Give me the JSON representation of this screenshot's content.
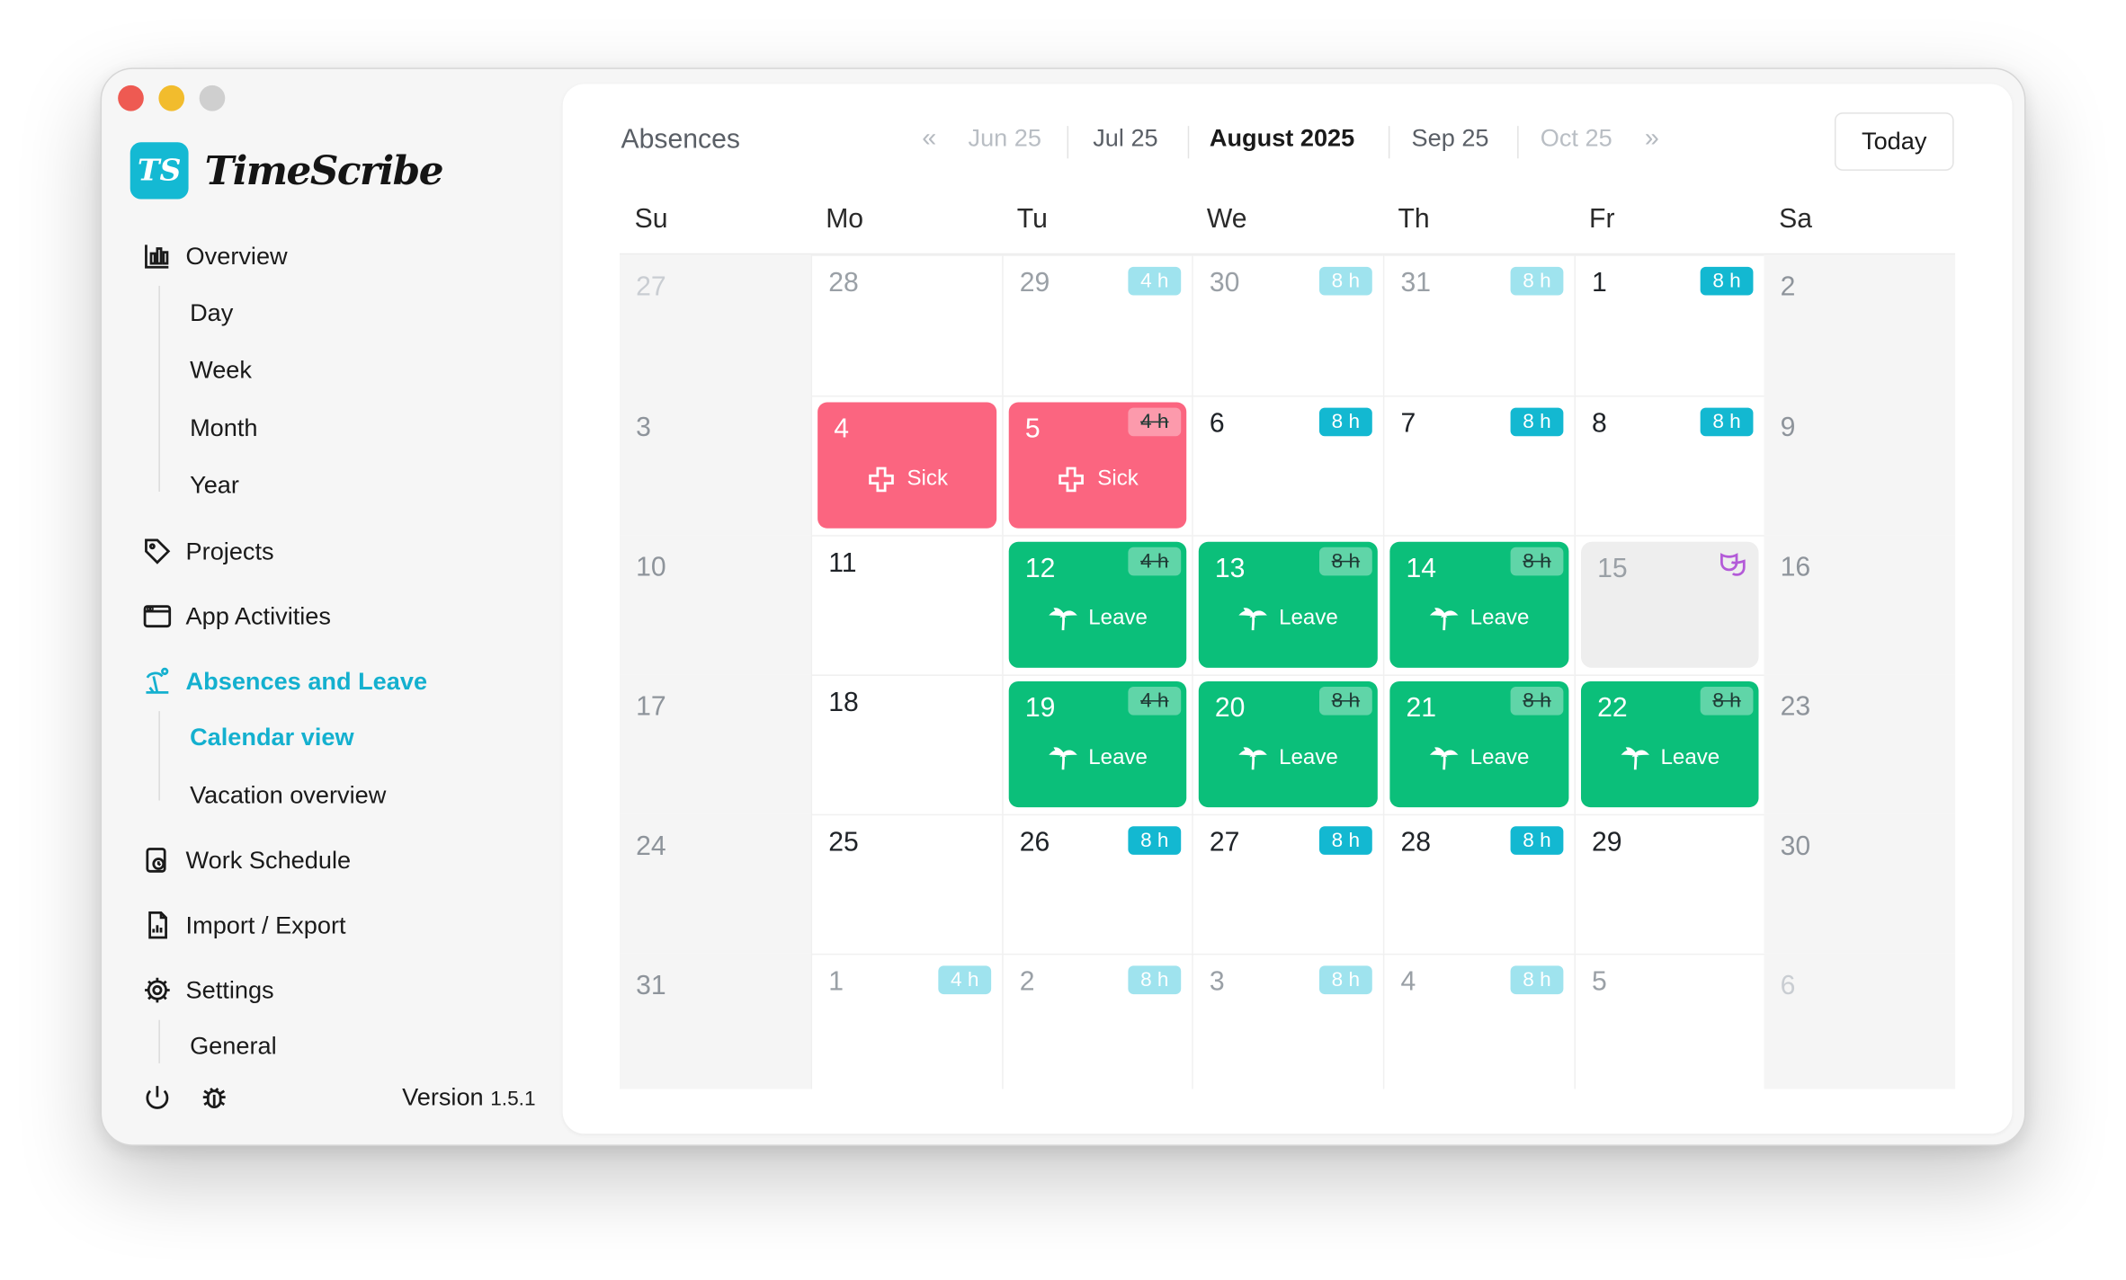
{
  "app": {
    "logo_text": "TS",
    "name": "TimeScribe"
  },
  "colors": {
    "accent": "#14b0cf",
    "sick": "#fb6580",
    "leave": "#0bbf7a",
    "badge": "#13b8d1",
    "badge_faded": "#9fe3ee",
    "close": "#ee5a52",
    "minimize": "#f2bc2d",
    "zoom": "#cfcfcf"
  },
  "sidebar": {
    "items": [
      {
        "label": "Overview",
        "icon": "bar-chart-icon"
      },
      {
        "label": "Projects",
        "icon": "tag-icon"
      },
      {
        "label": "App Activities",
        "icon": "window-icon"
      },
      {
        "label": "Absences and Leave",
        "icon": "beach-icon",
        "active": true
      },
      {
        "label": "Work Schedule",
        "icon": "schedule-icon"
      },
      {
        "label": "Import / Export",
        "icon": "file-chart-icon"
      },
      {
        "label": "Settings",
        "icon": "gear-icon"
      }
    ],
    "overview_subitems": [
      "Day",
      "Week",
      "Month",
      "Year"
    ],
    "absences_subitems": [
      {
        "label": "Calendar view",
        "active": true
      },
      {
        "label": "Vacation overview"
      }
    ],
    "settings_subitems": [
      "General"
    ],
    "footer": {
      "version_label": "Version",
      "version_number": "1.5.1",
      "power_icon": "power-icon",
      "bug_icon": "bug-icon"
    }
  },
  "header": {
    "title": "Absences",
    "months": [
      "Jun 25",
      "Jul 25",
      "August 2025",
      "Sep 25",
      "Oct 25"
    ],
    "current_month_index": 2,
    "prev_icon": "«",
    "next_icon": "»",
    "today_label": "Today"
  },
  "weekdays": [
    "Su",
    "Mo",
    "Tu",
    "We",
    "Th",
    "Fr",
    "Sa"
  ],
  "weeks": [
    [
      {
        "day": "27",
        "outside": true
      },
      {
        "day": "28",
        "outside": true
      },
      {
        "day": "29",
        "outside": true,
        "badge": "4 h"
      },
      {
        "day": "30",
        "outside": true,
        "badge": "8 h"
      },
      {
        "day": "31",
        "outside": true,
        "badge": "8 h"
      },
      {
        "day": "1",
        "badge": "8 h"
      },
      {
        "day": "2"
      }
    ],
    [
      {
        "day": "3"
      },
      {
        "day": "4",
        "absence": "sick",
        "label": "Sick"
      },
      {
        "day": "5",
        "absence": "sick",
        "label": "Sick",
        "badge": "4 h"
      },
      {
        "day": "6",
        "badge": "8 h"
      },
      {
        "day": "7",
        "badge": "8 h"
      },
      {
        "day": "8",
        "badge": "8 h"
      },
      {
        "day": "9"
      }
    ],
    [
      {
        "day": "10"
      },
      {
        "day": "11"
      },
      {
        "day": "12",
        "absence": "leave",
        "label": "Leave",
        "badge": "4 h"
      },
      {
        "day": "13",
        "absence": "leave",
        "label": "Leave",
        "badge": "8 h"
      },
      {
        "day": "14",
        "absence": "leave",
        "label": "Leave",
        "badge": "8 h"
      },
      {
        "day": "15",
        "holiday": true
      },
      {
        "day": "16"
      }
    ],
    [
      {
        "day": "17"
      },
      {
        "day": "18"
      },
      {
        "day": "19",
        "absence": "leave",
        "label": "Leave",
        "badge": "4 h"
      },
      {
        "day": "20",
        "absence": "leave",
        "label": "Leave",
        "badge": "8 h"
      },
      {
        "day": "21",
        "absence": "leave",
        "label": "Leave",
        "badge": "8 h"
      },
      {
        "day": "22",
        "absence": "leave",
        "label": "Leave",
        "badge": "8 h"
      },
      {
        "day": "23"
      }
    ],
    [
      {
        "day": "24"
      },
      {
        "day": "25"
      },
      {
        "day": "26",
        "badge": "8 h"
      },
      {
        "day": "27",
        "badge": "8 h"
      },
      {
        "day": "28",
        "badge": "8 h"
      },
      {
        "day": "29"
      },
      {
        "day": "30"
      }
    ],
    [
      {
        "day": "31"
      },
      {
        "day": "1",
        "outside": true,
        "badge": "4 h"
      },
      {
        "day": "2",
        "outside": true,
        "badge": "8 h"
      },
      {
        "day": "3",
        "outside": true,
        "badge": "8 h"
      },
      {
        "day": "4",
        "outside": true,
        "badge": "8 h"
      },
      {
        "day": "5",
        "outside": true
      },
      {
        "day": "6",
        "outside": true
      }
    ]
  ]
}
